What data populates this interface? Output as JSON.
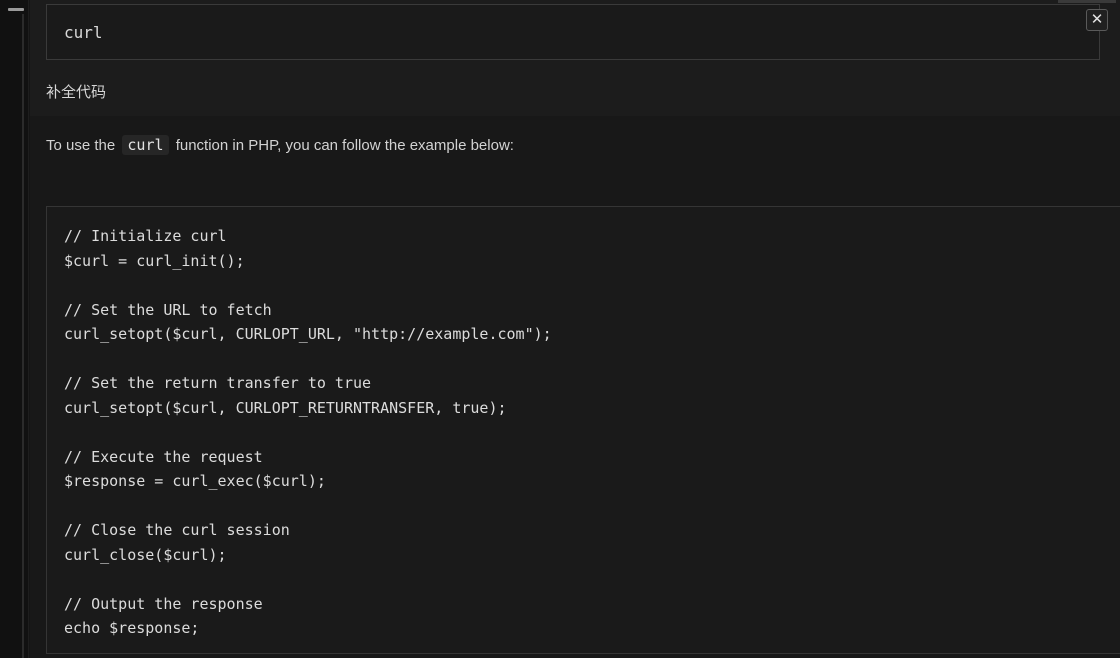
{
  "prompt": {
    "value": "curl"
  },
  "close_label": "✕",
  "section_label": "补全代码",
  "description": {
    "before": "To use the",
    "code": "curl",
    "after": "function in PHP, you can follow the example below:"
  },
  "code_lines": [
    "// Initialize curl",
    "$curl = curl_init();",
    "",
    "// Set the URL to fetch",
    "curl_setopt($curl, CURLOPT_URL, \"http://example.com\");",
    "",
    "// Set the return transfer to true",
    "curl_setopt($curl, CURLOPT_RETURNTRANSFER, true);",
    "",
    "// Execute the request",
    "$response = curl_exec($curl);",
    "",
    "// Close the curl session",
    "curl_close($curl);",
    "",
    "// Output the response",
    "echo $response;"
  ],
  "icons": {
    "close": "close-icon"
  },
  "colors": {
    "background": "#151515",
    "panel": "#181818",
    "border": "#3a3a3a",
    "text": "#d4d4d4"
  }
}
